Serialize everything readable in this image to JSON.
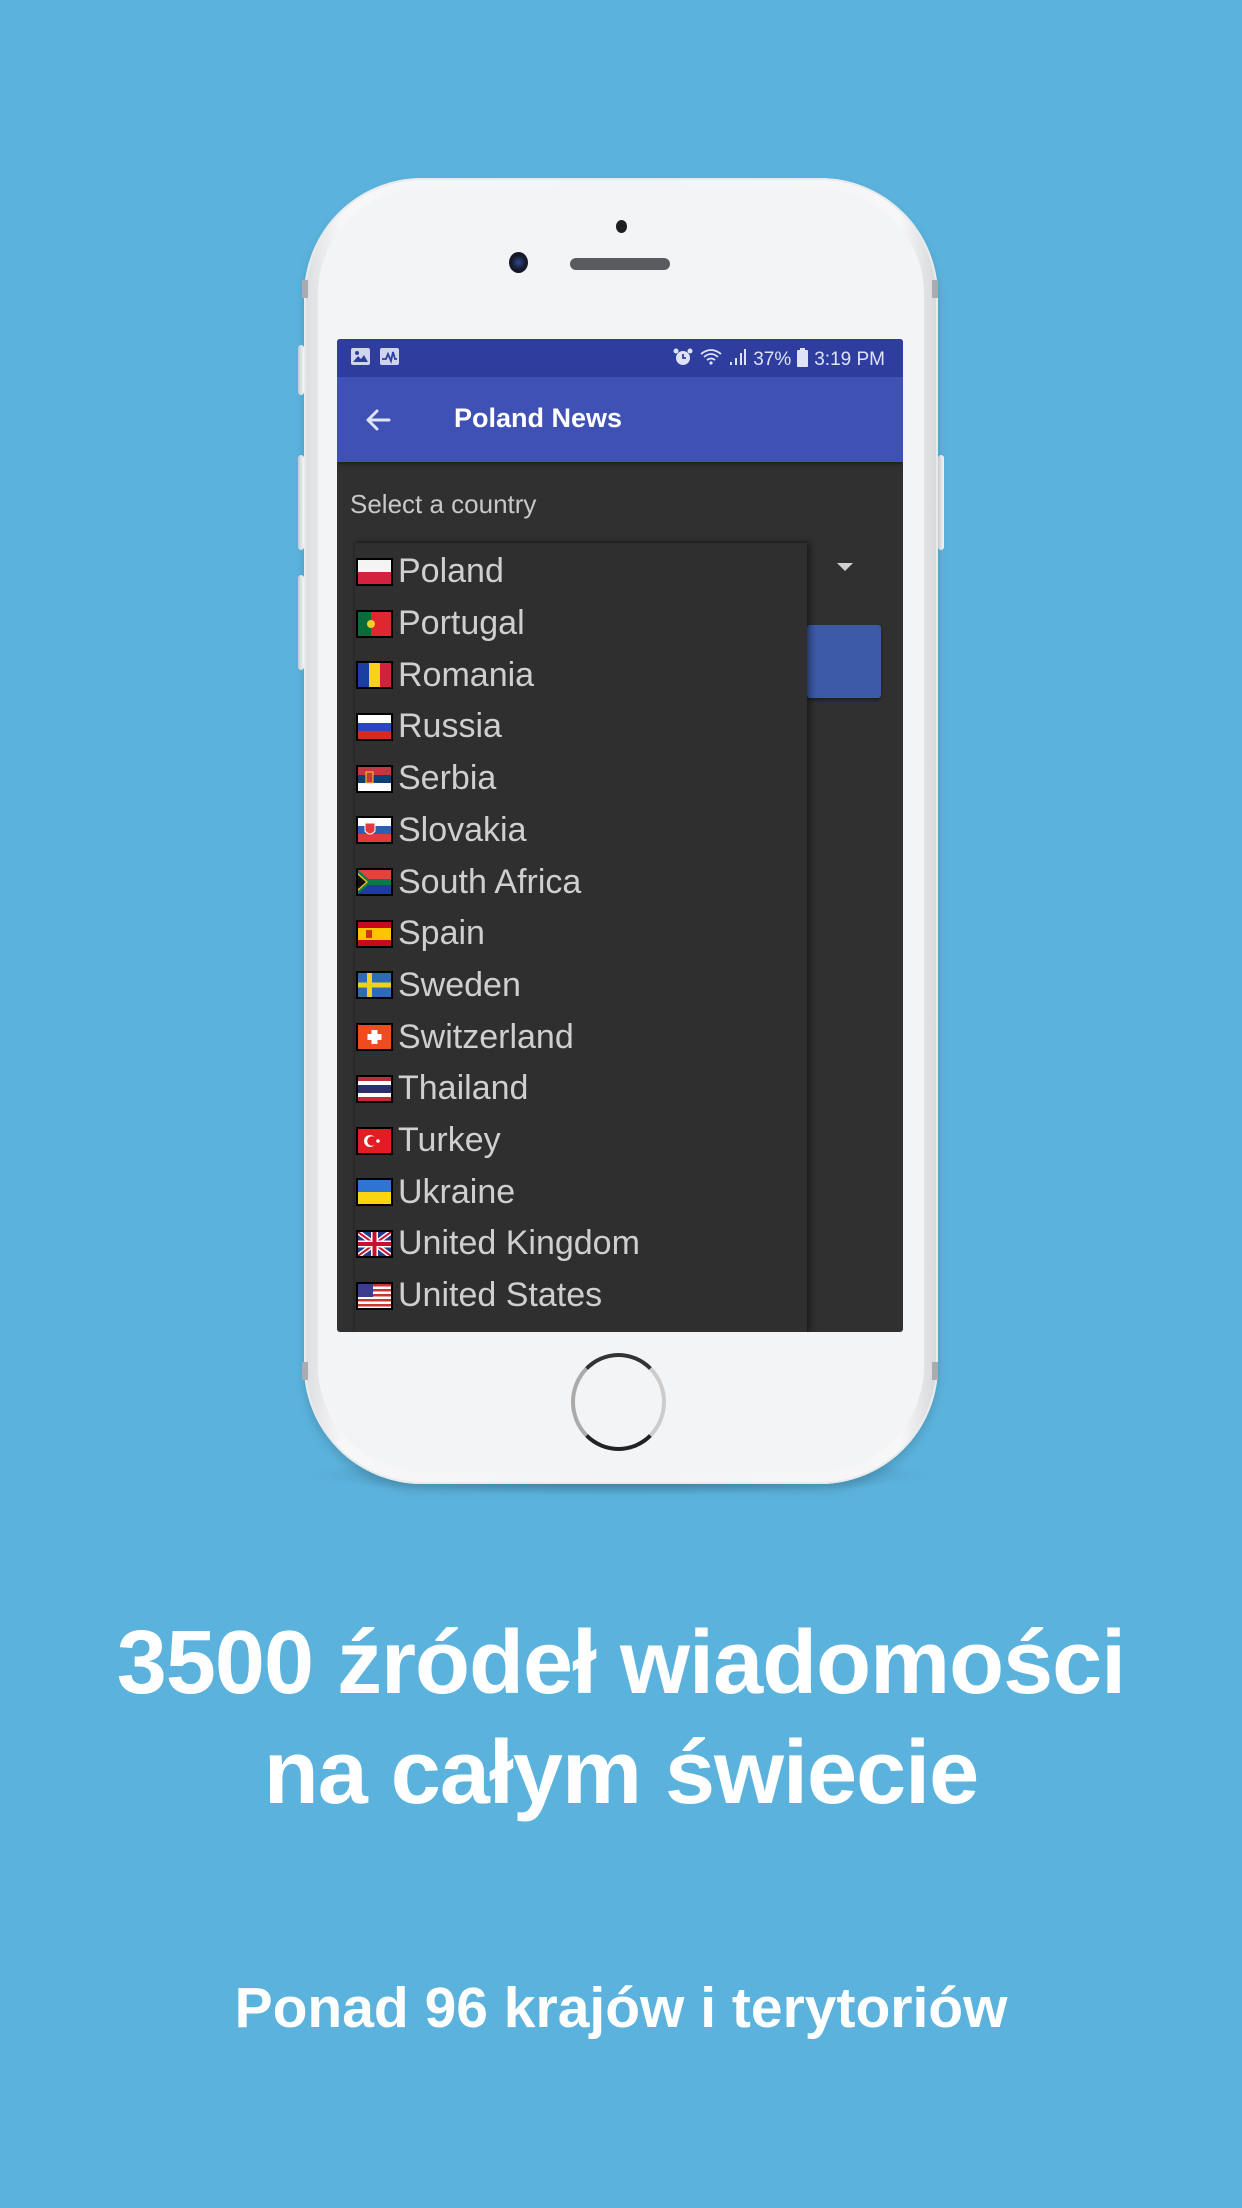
{
  "colors": {
    "background": "#5bb3dd",
    "status_bar": "#2f3e9e",
    "toolbar": "#3f51b5",
    "screen_bg": "#303030",
    "text_light": "#cfcfcf"
  },
  "status_bar": {
    "left_icons": [
      "gallery-icon",
      "activity-icon"
    ],
    "right_icons": [
      "alarm-icon",
      "wifi-icon",
      "signal-icon",
      "battery-icon"
    ],
    "battery": "37%",
    "time": "3:19 PM"
  },
  "toolbar": {
    "back_icon": "arrow-left-icon",
    "title": "Poland News"
  },
  "content": {
    "select_label": "Select a country",
    "spinner_icon": "dropdown-arrow-icon"
  },
  "dropdown": {
    "items": [
      {
        "label": "Poland",
        "flag": "pl"
      },
      {
        "label": "Portugal",
        "flag": "pt"
      },
      {
        "label": "Romania",
        "flag": "ro"
      },
      {
        "label": "Russia",
        "flag": "ru"
      },
      {
        "label": "Serbia",
        "flag": "rs"
      },
      {
        "label": "Slovakia",
        "flag": "sk"
      },
      {
        "label": "South Africa",
        "flag": "za"
      },
      {
        "label": "Spain",
        "flag": "es"
      },
      {
        "label": "Sweden",
        "flag": "se"
      },
      {
        "label": "Switzerland",
        "flag": "ch"
      },
      {
        "label": "Thailand",
        "flag": "th"
      },
      {
        "label": "Turkey",
        "flag": "tr"
      },
      {
        "label": "Ukraine",
        "flag": "ua"
      },
      {
        "label": "United Kingdom",
        "flag": "gb"
      },
      {
        "label": "United States",
        "flag": "us"
      }
    ]
  },
  "promo": {
    "headline_line1": "3500 źródeł wiadomości",
    "headline_line2": "na całym świecie",
    "subline": "Ponad 96 krajów i terytoriów"
  }
}
